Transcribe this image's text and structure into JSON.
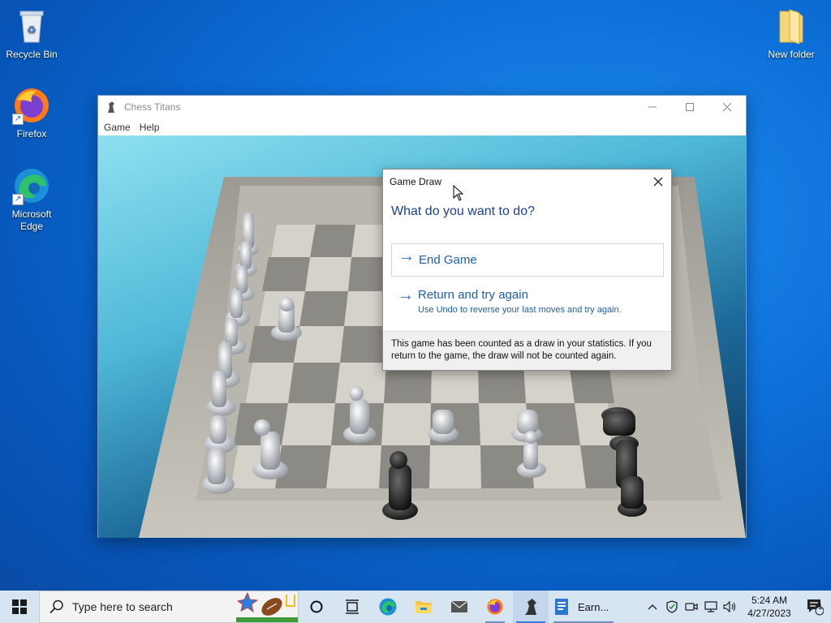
{
  "desktop": {
    "icons": [
      {
        "label": "Recycle Bin"
      },
      {
        "label": "Firefox"
      },
      {
        "label": "Microsoft Edge"
      },
      {
        "label": "New folder"
      }
    ]
  },
  "window": {
    "title": "Chess Titans",
    "menu": [
      "Game",
      "Help"
    ]
  },
  "dialog": {
    "title": "Game Draw",
    "question": "What do you want to do?",
    "options": [
      {
        "label": "End Game",
        "sub": ""
      },
      {
        "label": "Return and try again",
        "sub": "Use Undo to reverse your last moves and try again."
      }
    ],
    "footer": "This game has been counted as a draw in your statistics. If you return to the game, the draw will not be counted again."
  },
  "taskbar": {
    "search_placeholder": "Type here to search",
    "earn_label": "Earn...",
    "clock_time": "5:24 AM",
    "clock_date": "4/27/2023",
    "notification_count": "1"
  },
  "colors": {
    "accent": "#1d5fae",
    "question": "#1c3f94",
    "taskbar": "#d7e4f2"
  }
}
